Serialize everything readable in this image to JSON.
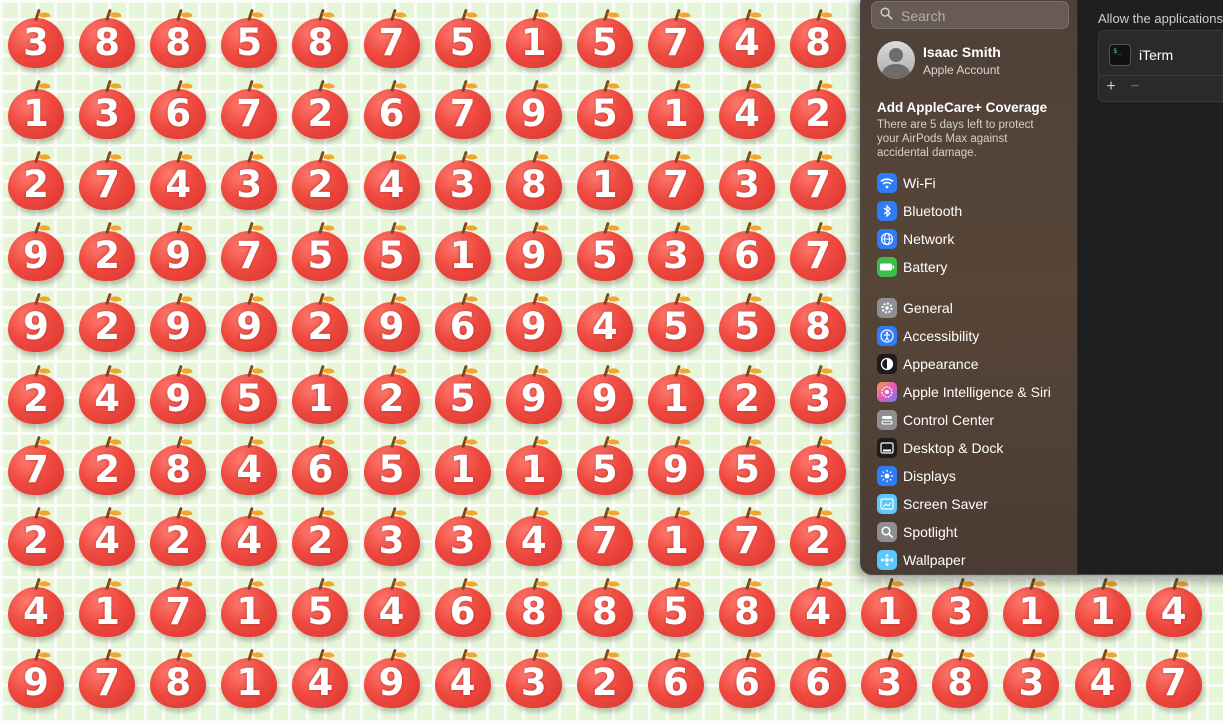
{
  "apple_grid": {
    "rows": [
      [
        "3",
        "8",
        "8",
        "5",
        "8",
        "7",
        "5",
        "1",
        "5",
        "7",
        "4",
        "8"
      ],
      [
        "1",
        "3",
        "6",
        "7",
        "2",
        "6",
        "7",
        "9",
        "5",
        "1",
        "4",
        "2"
      ],
      [
        "2",
        "7",
        "4",
        "3",
        "2",
        "4",
        "3",
        "8",
        "1",
        "7",
        "3",
        "7"
      ],
      [
        "9",
        "2",
        "9",
        "7",
        "5",
        "5",
        "1",
        "9",
        "5",
        "3",
        "6",
        "7"
      ],
      [
        "9",
        "2",
        "9",
        "9",
        "2",
        "9",
        "6",
        "9",
        "4",
        "5",
        "5",
        "8"
      ],
      [
        "2",
        "4",
        "9",
        "5",
        "1",
        "2",
        "5",
        "9",
        "9",
        "1",
        "2",
        "3"
      ],
      [
        "7",
        "2",
        "8",
        "4",
        "6",
        "5",
        "1",
        "1",
        "5",
        "9",
        "5",
        "3"
      ],
      [
        "2",
        "4",
        "2",
        "4",
        "2",
        "3",
        "3",
        "4",
        "7",
        "1",
        "7",
        "2"
      ],
      [
        "4",
        "1",
        "7",
        "1",
        "5",
        "4",
        "6",
        "8",
        "8",
        "5",
        "8",
        "4",
        "1",
        "3",
        "1",
        "1",
        "4"
      ],
      [
        "9",
        "7",
        "8",
        "1",
        "4",
        "9",
        "4",
        "3",
        "2",
        "6",
        "6",
        "6",
        "3",
        "8",
        "3",
        "4",
        "7"
      ]
    ]
  },
  "settings": {
    "search": {
      "placeholder": "Search"
    },
    "account": {
      "name": "Isaac Smith",
      "subtitle": "Apple Account"
    },
    "applecare": {
      "title": "Add AppleCare+ Coverage",
      "description": "There are 5 days left to protect your AirPods Max against accidental damage."
    },
    "sidebar_group1": [
      {
        "label": "Wi-Fi",
        "icon": "wifi-icon",
        "color": "#2f7cf6"
      },
      {
        "label": "Bluetooth",
        "icon": "bluetooth-icon",
        "color": "#2f7cf6"
      },
      {
        "label": "Network",
        "icon": "network-icon",
        "color": "#2f7cf6"
      },
      {
        "label": "Battery",
        "icon": "battery-icon",
        "color": "#3dbd4a"
      }
    ],
    "sidebar_group2": [
      {
        "label": "General",
        "icon": "gear-icon",
        "color": "#8e8e93"
      },
      {
        "label": "Accessibility",
        "icon": "accessibility-icon",
        "color": "#2f7cf6"
      },
      {
        "label": "Appearance",
        "icon": "appearance-icon",
        "color": "#1c1c1e"
      },
      {
        "label": "Apple Intelligence & Siri",
        "icon": "siri-icon",
        "color": "#d26ad0"
      },
      {
        "label": "Control Center",
        "icon": "control-center-icon",
        "color": "#8e8e93"
      },
      {
        "label": "Desktop & Dock",
        "icon": "dock-icon",
        "color": "#1c1c1e"
      },
      {
        "label": "Displays",
        "icon": "displays-icon",
        "color": "#2f7cf6"
      },
      {
        "label": "Screen Saver",
        "icon": "screen-saver-icon",
        "color": "#5ac8fa"
      },
      {
        "label": "Spotlight",
        "icon": "spotlight-icon",
        "color": "#8e8e93"
      },
      {
        "label": "Wallpaper",
        "icon": "wallpaper-icon",
        "color": "#5ac8fa"
      }
    ],
    "content": {
      "allow_label": "Allow the applications below to…",
      "apps": [
        {
          "name": "iTerm"
        }
      ],
      "add_label": "+",
      "remove_label": "−"
    }
  }
}
